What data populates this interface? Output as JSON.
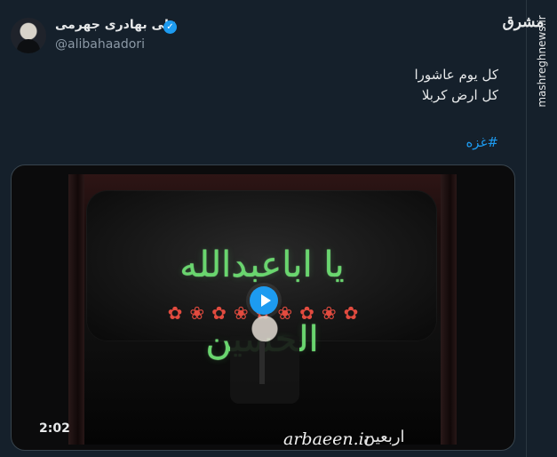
{
  "brand": {
    "logo_text": "مشرق",
    "site_text": "mashreghnews.ir"
  },
  "author": {
    "display_name": "علی بهادری جهرمی",
    "handle": "@alibahaadori"
  },
  "tweet": {
    "line1": "کل یوم عاشورا",
    "line2": "کل ارض کربلا",
    "hashtag": "#غزه"
  },
  "video": {
    "duration": "2:02",
    "watermark": "arbaeen.ir",
    "watermark_mark": "اربعین",
    "calligraphy": "یا اباعبدالله الحسین"
  },
  "icons": {
    "verified": "verified-badge-icon",
    "play": "play-icon"
  },
  "colors": {
    "accent": "#1d9bf0",
    "background": "#15202b",
    "text": "#e7e9ea",
    "muted": "#8b98a5"
  }
}
